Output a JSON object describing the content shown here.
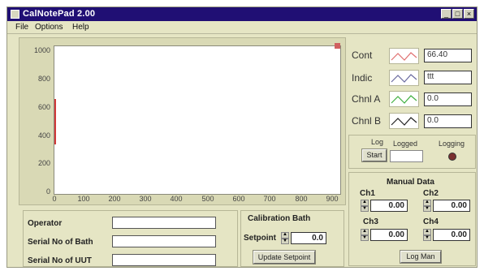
{
  "window": {
    "title": "CalNotePad 2.00",
    "controls": [
      "_",
      "□",
      "×"
    ]
  },
  "menu": [
    "File",
    "Options",
    "Help"
  ],
  "graph": {
    "y_ticks": [
      "1000",
      "800",
      "600",
      "400",
      "200",
      "0"
    ],
    "x_ticks": [
      "0",
      "100",
      "200",
      "300",
      "400",
      "500",
      "600",
      "700",
      "800",
      "900"
    ]
  },
  "legend": [
    {
      "label": "Cont",
      "value": "66.40",
      "color": "#e07070"
    },
    {
      "label": "Indic",
      "value": "ttt",
      "color": "#6a6aa0"
    },
    {
      "label": "Chnl A",
      "value": "0.0",
      "color": "#40b040"
    },
    {
      "label": "Chnl B",
      "value": "0.0",
      "color": "#222222"
    }
  ],
  "log": {
    "log_label": "Log",
    "start_label": "Start",
    "logged_label": "Logged",
    "logging_label": "Logging"
  },
  "manual": {
    "heading": "Manual Data",
    "channels": [
      {
        "label": "Ch1",
        "value": "0.00"
      },
      {
        "label": "Ch2",
        "value": "0.00"
      },
      {
        "label": "Ch3",
        "value": "0.00"
      },
      {
        "label": "Ch4",
        "value": "0.00"
      }
    ],
    "log_button": "Log Man"
  },
  "info": {
    "operator": "Operator",
    "serial_bath": "Serial No of Bath",
    "serial_uut": "Serial No of UUT"
  },
  "bath": {
    "heading": "Calibration Bath",
    "setpoint_label": "Setpoint",
    "setpoint_value": "0.0",
    "update_button": "Update Setpoint"
  }
}
